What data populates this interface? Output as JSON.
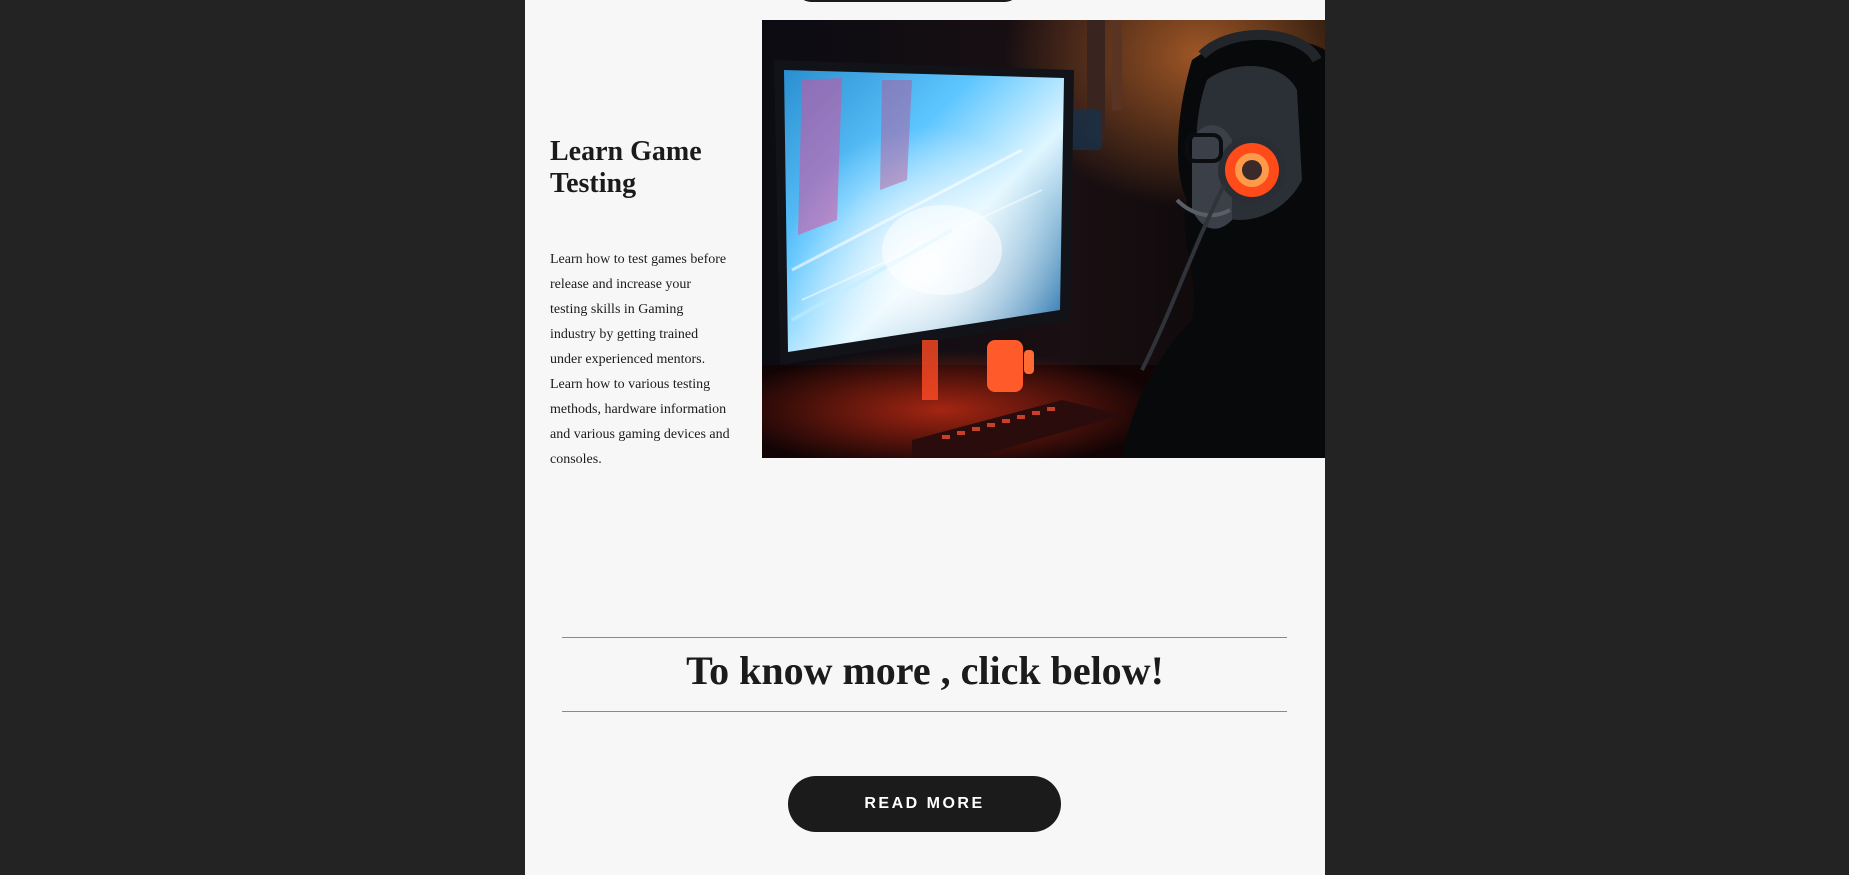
{
  "hero": {
    "title": "Learn Game Testing",
    "paragraph_1": "Learn how to test games before release and increase your testing skills in Gaming industry by getting trained under experienced mentors.",
    "paragraph_2": "Learn how to various testing methods, hardware information and various gaming devices and consoles.",
    "image_alt": "Gamer with glowing headset playing a game on a monitor"
  },
  "cta": {
    "heading": "To know more , click below!",
    "button_label": "READ MORE"
  },
  "colors": {
    "backdrop": "#232323",
    "page": "#f7f7f7",
    "text": "#1b1b1b",
    "button": "#1b1b1b",
    "button_text": "#ffffff",
    "rule": "#8a8a8a"
  }
}
